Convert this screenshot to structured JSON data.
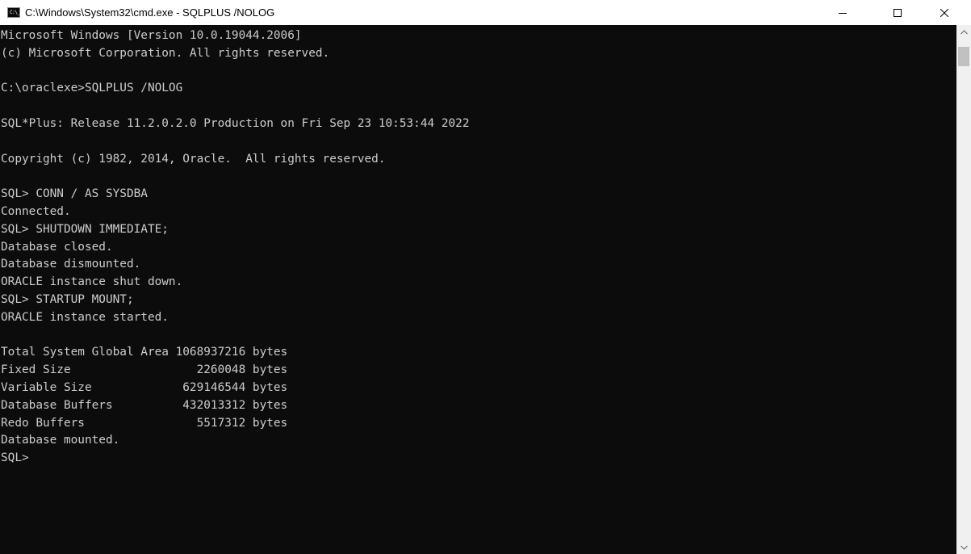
{
  "window": {
    "title": "C:\\Windows\\System32\\cmd.exe - SQLPLUS  /NOLOG",
    "app_icon_glyph": "C:\\_",
    "icons": [
      "cmd-app-icon",
      "minimize-icon",
      "maximize-icon",
      "close-icon"
    ]
  },
  "console": {
    "lines": [
      "Microsoft Windows [Version 10.0.19044.2006]",
      "(c) Microsoft Corporation. All rights reserved.",
      "",
      "C:\\oraclexe>SQLPLUS /NOLOG",
      "",
      "SQL*Plus: Release 11.2.0.2.0 Production on Fri Sep 23 10:53:44 2022",
      "",
      "Copyright (c) 1982, 2014, Oracle.  All rights reserved.",
      "",
      "SQL> CONN / AS SYSDBA",
      "Connected.",
      "SQL> SHUTDOWN IMMEDIATE;",
      "Database closed.",
      "Database dismounted.",
      "ORACLE instance shut down.",
      "SQL> STARTUP MOUNT;",
      "ORACLE instance started.",
      "",
      "Total System Global Area 1068937216 bytes",
      "Fixed Size                  2260048 bytes",
      "Variable Size             629146544 bytes",
      "Database Buffers          432013312 bytes",
      "Redo Buffers                5517312 bytes",
      "Database mounted.",
      "SQL>"
    ]
  },
  "colors": {
    "console_background": "#0c0c0c",
    "console_text": "#cccccc",
    "titlebar_background": "#ffffff"
  }
}
